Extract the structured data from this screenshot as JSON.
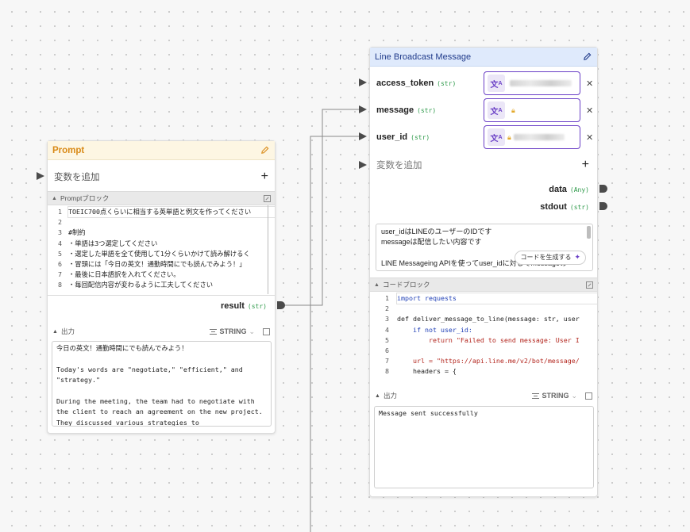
{
  "prompt_node": {
    "title": "Prompt",
    "add_variable": "変数を追加",
    "block_title": "Promptブロック",
    "code_lines": [
      {
        "n": "1",
        "text": "TOEIC700点くらいに相当する英単語と例文を作ってください"
      },
      {
        "n": "2",
        "text": ""
      },
      {
        "n": "3",
        "text": "#制約"
      },
      {
        "n": "4",
        "text": "・単語は3つ選定してください"
      },
      {
        "n": "5",
        "text": "・選定した単語を全て使用して1分くらいかけて読み解けるく"
      },
      {
        "n": "6",
        "text": "・冒頭には「今日の英文！通勤時間にでも読んでみよう！」"
      },
      {
        "n": "7",
        "text": "・最後に日本語訳を入れてください。"
      },
      {
        "n": "8",
        "text": "・毎回配信内容が変わるように工夫してください"
      }
    ],
    "output_name": "result",
    "output_type": "(str)",
    "output_section_label": "出力",
    "output_format": "STRING",
    "output_text": "今日の英文！通勤時間にでも読んでみよう！\n\nToday's words are \"negotiate,\" \"efficient,\" and \"strategy.\"\n\nDuring the meeting, the team had to negotiate with the client to reach an agreement on the new project. They discussed various strategies to"
  },
  "line_node": {
    "title": "Line Broadcast Message",
    "inputs": [
      {
        "name": "access_token",
        "type": "(str)"
      },
      {
        "name": "message",
        "type": "(str)"
      },
      {
        "name": "user_id",
        "type": "(str)"
      }
    ],
    "add_variable": "変数を追加",
    "outputs": [
      {
        "name": "data",
        "type": "(Any)"
      },
      {
        "name": "stdout",
        "type": "(str)"
      }
    ],
    "description_lines": [
      "user_idはLINEのユーザーのIDです",
      "messageは配信したい内容です",
      "",
      "LINE Messageing APIを使ってuser_idに対してmessageの"
    ],
    "generate_code_button": "コードを生成する",
    "code_block_title": "コードブロック",
    "code_lines": [
      {
        "n": "1",
        "text": "import requests"
      },
      {
        "n": "2",
        "text": ""
      },
      {
        "n": "3",
        "text": "def deliver_message_to_line(message: str, user"
      },
      {
        "n": "4",
        "text": "    if not user_id:"
      },
      {
        "n": "5",
        "text": "        return \"Failed to send message: User I"
      },
      {
        "n": "6",
        "text": ""
      },
      {
        "n": "7",
        "text": "    url = \"https://api.line.me/v2/bot/message/"
      },
      {
        "n": "8",
        "text": "    headers = {"
      }
    ],
    "output_section_label": "出力",
    "output_format": "STRING",
    "output_text": "Message sent successfully"
  },
  "colors": {
    "prompt_accent": "#d98a17",
    "line_header": "#dfeafc",
    "secret_border": "#6a3fc6",
    "type_green": "#2e9a4a"
  }
}
